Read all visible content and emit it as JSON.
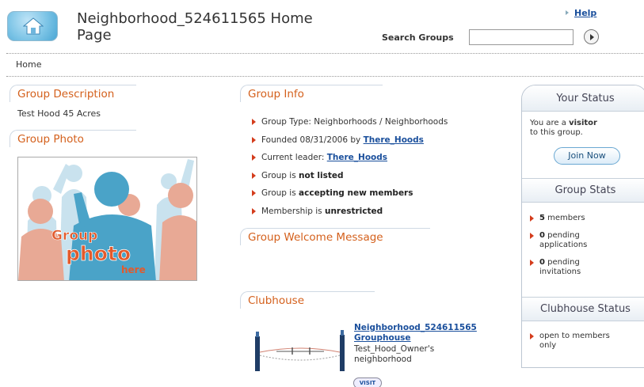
{
  "header": {
    "title": "Neighborhood_524611565 Home Page",
    "help_label": "Help",
    "search_label": "Search Groups",
    "search_value": ""
  },
  "breadcrumb": "Home",
  "group_description": {
    "heading": "Group Description",
    "text": "Test Hood 45 Acres"
  },
  "group_photo": {
    "heading": "Group Photo",
    "placeholder_line1": "Group",
    "placeholder_line2": "photo",
    "placeholder_line3": "here"
  },
  "group_info": {
    "heading": "Group Info",
    "type_prefix": "Group Type: ",
    "type_value": "Neighborhoods / Neighborhoods",
    "founded_prefix": "Founded 08/31/2006 by ",
    "founded_by": "There_Hoods",
    "leader_prefix": "Current leader: ",
    "leader": "There_Hoods",
    "listed_prefix": "Group is ",
    "listed_value": "not listed",
    "accepting_prefix": "Group is ",
    "accepting_value": "accepting new members",
    "membership_prefix": "Membership is ",
    "membership_value": "unrestricted"
  },
  "welcome": {
    "heading": "Group Welcome Message"
  },
  "clubhouse": {
    "heading": "Clubhouse",
    "name_line1": "Neighborhood_524611565",
    "name_line2": "Grouphouse",
    "desc_line1": "Test_Hood_Owner's",
    "desc_line2": "neighborhood",
    "visit_label": "VISIT"
  },
  "your_status": {
    "heading": "Your Status",
    "prefix": "You are a ",
    "role": "visitor",
    "suffix": "to this group.",
    "join_label": "Join Now"
  },
  "group_stats": {
    "heading": "Group Stats",
    "members_count": "5",
    "members_label": " members",
    "pending_apps_count": "0",
    "pending_apps_label1": " pending",
    "pending_apps_label2": "applications",
    "pending_inv_count": "0",
    "pending_inv_label1": " pending",
    "pending_inv_label2": "invitations"
  },
  "clubhouse_status": {
    "heading": "Clubhouse Status",
    "line1": "open to members",
    "line2": "only"
  },
  "colors": {
    "heading_orange": "#d4601c",
    "link_blue": "#1a4f9c",
    "bullet_red": "#d43c1c"
  }
}
